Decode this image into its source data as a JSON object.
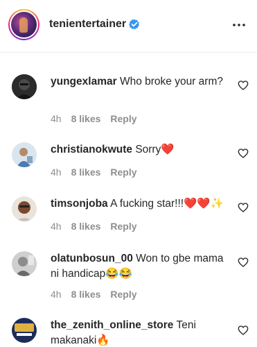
{
  "header": {
    "username": "tenientertainer",
    "verified": true,
    "verified_color": "#3897f0",
    "avatar_icon": "profile-avatar",
    "more_icon": "more-horizontal-icon"
  },
  "comments": [
    {
      "username": "yungexlamar",
      "text": "Who broke your arm?",
      "time": "4h",
      "likes": "8 likes",
      "reply": "Reply"
    },
    {
      "username": "christianokwute",
      "text": "Sorry❤️",
      "time": "4h",
      "likes": "8 likes",
      "reply": "Reply"
    },
    {
      "username": "timsonjoba",
      "text": "A fucking star!!!❤️❤️✨",
      "time": "4h",
      "likes": "8 likes",
      "reply": "Reply"
    },
    {
      "username": "olatunbosun_00",
      "text": "Won to gbe mama ni handicap😂😂",
      "time": "4h",
      "likes": "8 likes",
      "reply": "Reply"
    },
    {
      "username": "the_zenith_online_store",
      "text": "Teni makanaki🔥",
      "time": "",
      "likes": "",
      "reply": ""
    }
  ],
  "colors": {
    "text": "#262626",
    "meta": "#8e8e8e",
    "divider": "#efefef"
  }
}
